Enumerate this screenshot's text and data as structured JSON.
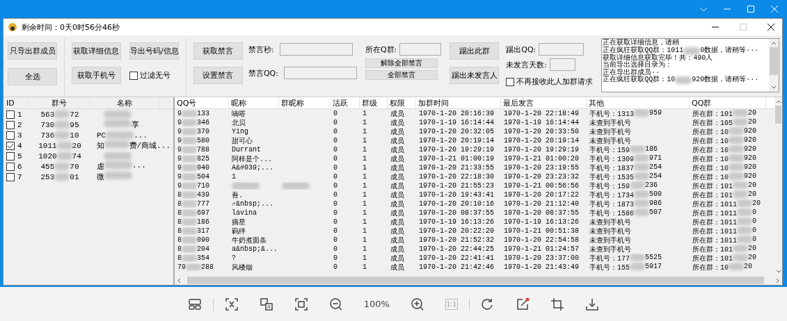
{
  "window": {
    "title": "剩余时间：0天0时56分46秒"
  },
  "toolbar": {
    "export_members": "只导出群成员",
    "select_all": "全选",
    "get_details": "获取详细信息",
    "get_phones": "获取手机号",
    "export_info": "导出号码/信息",
    "filter": {
      "label": "过滤无号",
      "checked": false
    },
    "get_mute": "获取禁言",
    "set_mute": "设置禁言",
    "mute_seconds": "禁言秒:",
    "mute_qq": "禁言QQ:",
    "group_label": "所在Q群:",
    "unmute_all": "解除全部禁言",
    "mute_all": "全部禁言",
    "kick_group": "踢出此群",
    "kick_silent": "踢出未发言人",
    "kick_qq": "踢出QQ:",
    "silent_days": "未发言天数:",
    "reject": {
      "label": "不再接收此人加群请求",
      "checked": false
    }
  },
  "log": [
    {
      "head": "正在获取详细信息，请稍"
    },
    {
      "head": "正在疯狂获取QQ群：1011",
      "tail": "0数据，请稍等···"
    },
    {
      "head": "获取详细信息获取完毕！共：490人"
    },
    {
      "head": "当前导出选择目录为："
    },
    {
      "head": "正在导出群成员··"
    },
    {
      "head": "正在疯狂获取QQ群：10",
      "tail": "920数据，请稍等···"
    }
  ],
  "groups": {
    "columns": [
      "ID",
      "群号",
      "名称"
    ],
    "rows": [
      {
        "id": "1",
        "checked": false,
        "num_head": "563",
        "num_tail": "72"
      },
      {
        "id": "2",
        "checked": false,
        "num_head": "730",
        "num_tail": "95",
        "name_tail": "享"
      },
      {
        "id": "3",
        "checked": false,
        "num_head": "736",
        "num_tail": "10",
        "name_head": "PC",
        "name_tail": "..."
      },
      {
        "id": "4",
        "checked": true,
        "num_head": "1011",
        "num_tail": "20",
        "name_head": "知",
        "name_tail": "费/商城..."
      },
      {
        "id": "5",
        "checked": false,
        "num_head": "1020",
        "num_tail": "74"
      },
      {
        "id": "6",
        "checked": false,
        "num_head": "455",
        "num_tail": "70",
        "name_head": "虐",
        "name_tail": "..."
      },
      {
        "id": "7",
        "checked": false,
        "num_head": "253",
        "num_tail": "01",
        "name_head": "微"
      }
    ]
  },
  "members": {
    "columns": [
      "QQ号",
      "昵称",
      "群昵称",
      "活跃",
      "群级",
      "权限",
      "加群时间",
      "最后发言",
      "其他",
      "QQ群"
    ],
    "rows": [
      {
        "qq_head": "9",
        "qq_tail": "133",
        "nick": "嘀嗒",
        "active": "0",
        "level": "1",
        "role": "成员",
        "joined": "1970-1-20 20:16:39",
        "last": "1970-1-20 22:18:49",
        "other_head": "手机号：1313",
        "other_tail": "959",
        "group_head": "所在群：101",
        "group_tail": "20"
      },
      {
        "qq_head": "9",
        "qq_tail": "346",
        "nick": "北贝",
        "active": "0",
        "level": "1",
        "role": "成员",
        "joined": "1970-1-19 16:14:44",
        "last": "1970-1-19 16:14:44",
        "other_head": "未查到手机号",
        "group_head": "所在群：105",
        "group_tail": "20"
      },
      {
        "qq_head": "9",
        "qq_tail": "370",
        "nick": "Ying",
        "active": "0",
        "level": "1",
        "role": "成员",
        "joined": "1970-1-20 20:32:05",
        "last": "1970-1-20 20:33:50",
        "other_head": "未查到手机号",
        "group_head": "所在群：10",
        "group_tail": "920"
      },
      {
        "qq_head": "9",
        "qq_tail": "580",
        "nick": "甜可心",
        "active": "0",
        "level": "1",
        "role": "成员",
        "joined": "1970-1-20 20:19:14",
        "last": "1970-1-20 20:19:14",
        "other_head": "未查到手机号",
        "group_head": "所在群：10",
        "group_tail": "920"
      },
      {
        "qq_head": "9",
        "qq_tail": "788",
        "nick": "Durrant",
        "active": "0",
        "level": "1",
        "role": "成员",
        "joined": "1970-1-20 19:29:19",
        "last": "1970-1-20 19:29:19",
        "other_head": "手机号：159",
        "other_tail": "186",
        "group_head": "所在群：10",
        "group_tail": "920"
      },
      {
        "qq_head": "9",
        "qq_tail": "825",
        "nick": "阿梓是个...",
        "active": "0",
        "level": "1",
        "role": "成员",
        "joined": "1970-1-21 01:00:19",
        "last": "1970-1-21 01:00:20",
        "other_head": "手机号：1309",
        "other_tail": "971",
        "group_head": "所在群：10",
        "group_tail": "920"
      },
      {
        "qq_head": "9",
        "qq_tail": "040",
        "nick": "A&#039;...",
        "active": "0",
        "level": "1",
        "role": "成员",
        "joined": "1970-1-20 21:33:55",
        "last": "1970-1-20 23:19:55",
        "other_head": "手机号：1837",
        "other_tail": "254",
        "group_head": "所在群：10",
        "group_tail": "920"
      },
      {
        "qq_head": "9",
        "qq_tail": "504",
        "nick": "1",
        "active": "0",
        "level": "1",
        "role": "成员",
        "joined": "1970-1-20 22:18:30",
        "last": "1970-1-20 23:23:32",
        "other_head": "手机号：1535",
        "other_tail": "254",
        "group_head": "所在群：10",
        "group_tail": "920"
      },
      {
        "qq_head": "9",
        "qq_tail": "710",
        "active": "0",
        "level": "1",
        "role": "成员",
        "joined": "1970-1-20 21:55:23",
        "last": "1970-1-21 00:56:56",
        "other_head": "手机号：159",
        "other_tail": "236",
        "group_head": "所在群：101",
        "group_tail": "20"
      },
      {
        "qq_head": "8",
        "qq_tail": "439",
        "nick": "吾.",
        "active": "0",
        "level": "1",
        "role": "成员",
        "joined": "1970-1-20 19:43:41",
        "last": "1970-1-20 20:17:22",
        "other_head": "手机号：1734",
        "other_tail": "500",
        "group_head": "所在群：101",
        "group_tail": "20"
      },
      {
        "qq_head": "8",
        "qq_tail": "777",
        "nick": "♂&nbsp;...",
        "active": "0",
        "level": "1",
        "role": "成员",
        "joined": "1970-1-20 20:10:16",
        "last": "1970-1-20 21:12:40",
        "other_head": "手机号：1873",
        "other_tail": "986",
        "group_head": "所在群：1011",
        "group_tail": "20"
      },
      {
        "qq_head": "8",
        "qq_tail": "697",
        "nick": "lavina",
        "active": "0",
        "level": "1",
        "role": "成员",
        "joined": "1970-1-20 08:37:55",
        "last": "1970-1-20 08:37:55",
        "other_head": "手机号：1586",
        "other_tail": "507",
        "group_head": "所在群：1011",
        "group_tail": "0"
      },
      {
        "qq_head": "8",
        "qq_tail": "186",
        "nick": "摘星",
        "active": "0",
        "level": "1",
        "role": "成员",
        "joined": "1970-1-19 16:13:26",
        "last": "1970-1-19 16:13:26",
        "other_head": "未查到手机号",
        "group_head": "所在群：1011",
        "group_tail": "0"
      },
      {
        "qq_head": "8",
        "qq_tail": "317",
        "nick": "羁绊",
        "active": "0",
        "level": "1",
        "role": "成员",
        "joined": "1970-1-20 20:22:20",
        "last": "1970-1-21 00:51:38",
        "other_head": "未查到手机号",
        "group_head": "所在群：1011",
        "group_tail": "0"
      },
      {
        "qq_head": "8",
        "qq_tail": "090",
        "nick": "牛奶煮面条",
        "active": "0",
        "level": "1",
        "role": "成员",
        "joined": "1970-1-20 21:52:32",
        "last": "1970-1-20 22:54:58",
        "other_head": "未查到手机号",
        "group_head": "所在群：1011",
        "group_tail": "0"
      },
      {
        "qq_head": "8",
        "qq_tail": "204",
        "nick": "a&nbsp;&...",
        "active": "0",
        "level": "1",
        "role": "成员",
        "joined": "1970-1-20 22:44:25",
        "last": "1970-1-21 01:24:57",
        "other_head": "未查到手机号",
        "group_head": "所在群：101",
        "group_tail": "20"
      },
      {
        "qq_head": "8",
        "qq_tail": "354",
        "nick": "?",
        "active": "0",
        "level": "1",
        "role": "成员",
        "joined": "1970-1-20 22:41:41",
        "last": "1970-1-20 23:37:00",
        "other_head": "手机号：177",
        "other_tail": "5525",
        "group_head": "所在群：101",
        "group_tail": "20"
      },
      {
        "qq_head": "79",
        "qq_tail": "288",
        "nick": "风楼烟",
        "active": "0",
        "level": "1",
        "role": "成员",
        "joined": "1970-1-20 21:42:46",
        "last": "1970-1-20 21:43:49",
        "other_head": "手机号：155",
        "other_tail": "5917",
        "group_head": "所在群：10",
        "group_tail": "20"
      }
    ]
  },
  "viewer": {
    "zoom": "100%",
    "reset": "1:1"
  }
}
